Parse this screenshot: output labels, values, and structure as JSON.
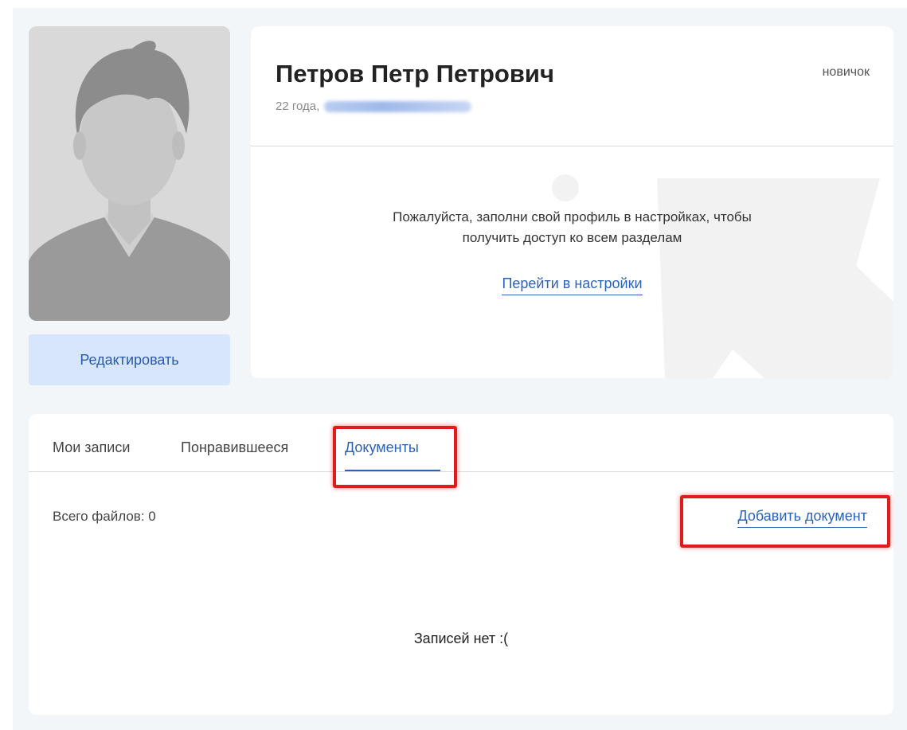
{
  "profile": {
    "name": "Петров Петр Петрович",
    "age": "22 года,",
    "level": "новичок",
    "prompt_line1": "Пожалуйста, заполни свой профиль в настройках, чтобы",
    "prompt_line2": "получить доступ ко всем разделам",
    "settings_link": "Перейти в настройки"
  },
  "avatar": {
    "edit_button": "Редактировать"
  },
  "tabs": [
    {
      "label": "Мои записи",
      "active": false
    },
    {
      "label": "Понравившееся",
      "active": false
    },
    {
      "label": "Документы",
      "active": true
    }
  ],
  "documents": {
    "files_count": "Всего файлов: 0",
    "add_button": "Добавить документ",
    "empty_message": "Записей нет :("
  },
  "colors": {
    "accent": "#2b63b7",
    "highlight": "#e01b1b",
    "edit_button_bg": "#d7e6fb"
  }
}
